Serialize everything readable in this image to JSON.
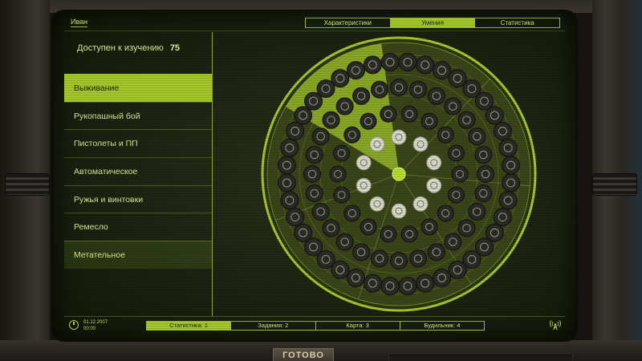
{
  "character": {
    "name": "Иван"
  },
  "tabs": [
    {
      "label": "Характеристики",
      "active": false
    },
    {
      "label": "Умения",
      "active": true
    },
    {
      "label": "Статистика",
      "active": false
    }
  ],
  "available": {
    "label": "Доступен к изучению",
    "value": "75"
  },
  "categories": [
    {
      "label": "Выживание",
      "state": "active"
    },
    {
      "label": "Рукопашный бой",
      "state": ""
    },
    {
      "label": "Пистолеты и ПП",
      "state": ""
    },
    {
      "label": "Автоматическое",
      "state": ""
    },
    {
      "label": "Ружья и винтовки",
      "state": ""
    },
    {
      "label": "Ремесло",
      "state": ""
    },
    {
      "label": "Метательное",
      "state": "dim"
    }
  ],
  "skill_wheel": {
    "sectors": 7,
    "selected_sector": 0,
    "rings": [
      {
        "count": 10,
        "style": "light"
      },
      {
        "count": 18,
        "style": "dark"
      },
      {
        "count": 28,
        "style": "dark"
      },
      {
        "count": 40,
        "style": "dark"
      }
    ]
  },
  "footer": {
    "date": "01.12.2007",
    "time": "00:00",
    "status_items": [
      {
        "label": "Статистика: 1",
        "active": true
      },
      {
        "label": "Задания: 2",
        "active": false
      },
      {
        "label": "Карта: 3",
        "active": false
      },
      {
        "label": "Будильник: 4",
        "active": false
      }
    ]
  },
  "done_button": {
    "label": "ГОТОВО"
  },
  "colors": {
    "accent": "#a5c72a",
    "screen_bg": "#1c2311",
    "text": "#d4e88a"
  }
}
